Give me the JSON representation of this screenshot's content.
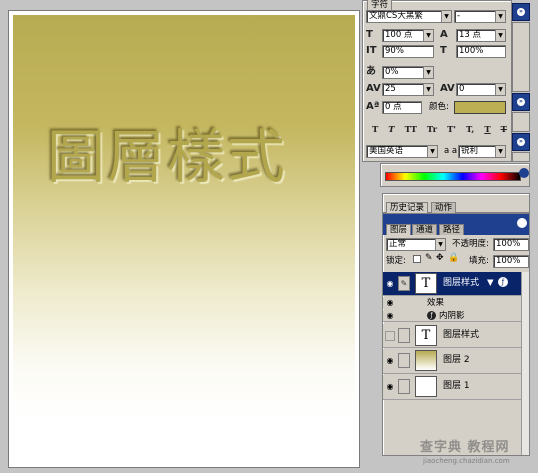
{
  "canvas": {
    "embossed_text": "圖層樣式"
  },
  "character_panel": {
    "tab_label": "字符",
    "font_family": "文鼎CS大黑繁",
    "font_style": "-",
    "font_size": "100 点",
    "leading": "13 点",
    "vertical_scale": "90%",
    "horizontal_scale": "100%",
    "tsume": "0%",
    "tracking": "25",
    "kerning": "0",
    "baseline_shift": "0 点",
    "color_label": "颜色:",
    "color_value": "#bcae52",
    "style_buttons": [
      "T",
      "T",
      "TT",
      "Tr",
      "T'",
      "T,",
      "T",
      "T"
    ],
    "language": "美国英语",
    "aa_label": "a a",
    "antialias": "锐利"
  },
  "history_panel": {
    "tabs": [
      "历史记录",
      "动作"
    ]
  },
  "layers_panel": {
    "tabs": [
      "图层",
      "通道",
      "路径"
    ],
    "blend_mode": "正常",
    "opacity_label": "不透明度:",
    "opacity": "100%",
    "lock_label": "锁定:",
    "fill_label": "填充:",
    "fill": "100%",
    "layers": [
      {
        "name": "图层样式",
        "thumb": "T",
        "selected": true,
        "visible": true,
        "fx": true
      },
      {
        "name": "图层样式",
        "thumb": "T",
        "selected": false,
        "visible": false,
        "fx": false
      },
      {
        "name": "图层 2",
        "thumb": "",
        "selected": false,
        "visible": true,
        "fx": false
      },
      {
        "name": "图层 1",
        "thumb": "",
        "selected": false,
        "visible": true,
        "fx": false
      }
    ],
    "effects_label": "效果",
    "effect_items": [
      "内阴影"
    ]
  },
  "watermark": {
    "main": "查字典 教程网",
    "sub": "jiaocheng.chazidian.com"
  }
}
